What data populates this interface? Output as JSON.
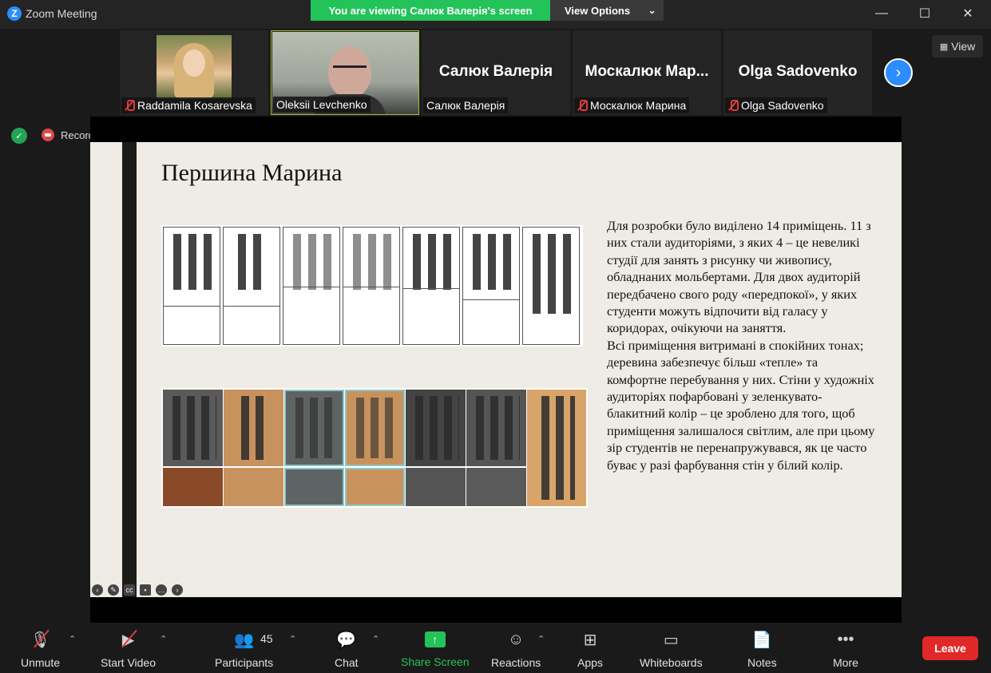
{
  "window": {
    "title": "Zoom Meeting",
    "logo_letter": "Z",
    "banner_text": "You are viewing Салюк Валерія's screen",
    "view_options": "View Options",
    "minimize": "—",
    "maximize": "☐",
    "close": "✕"
  },
  "thumbnails": [
    {
      "name": "Raddamila Kosarevska",
      "muted": true,
      "type": "photo"
    },
    {
      "name": "Oleksii Levchenko",
      "muted": false,
      "type": "camera",
      "active": true
    },
    {
      "name": "Салюк Валерія",
      "big_name": "Салюк Валерія",
      "muted": false,
      "type": "name"
    },
    {
      "name": "Москалюк Марина",
      "big_name": "Москалюк  Мар...",
      "muted": true,
      "type": "name"
    },
    {
      "name": "Olga Sadovenko",
      "big_name": "Olga Sadovenko",
      "muted": true,
      "type": "name"
    }
  ],
  "view_button": "View",
  "recording": "Recording",
  "slide": {
    "title": "Першина Марина",
    "paragraphs": [
      "Для розробки було виділено 14 приміщень. 11 з них стали аудиторіями, з яких 4 – це невеликі студії для занять з рисунку чи живопису, обладнаних мольбертами. Для двох аудиторій передбачено свого роду «передпокої», у яких студенти можуть відпочити від галасу у коридорах, очікуючи на заняття.",
      "Всі приміщення витримані в спокійних тонах; деревина забезпечує більш «тепле» та комфортне перебування у них. Стіни у художніх аудиторіях пофарбовані у зеленкувато-блакитний колір – це зроблено для того, щоб приміщення залишалося світлим, але при цьому зір студентів не перенапружувався, як це часто буває у разі фарбування стін у білий колір."
    ]
  },
  "toolbar": {
    "unmute": "Unmute",
    "start_video": "Start Video",
    "participants": "Participants",
    "participants_count": "45",
    "chat": "Chat",
    "share_screen": "Share Screen",
    "reactions": "Reactions",
    "apps": "Apps",
    "whiteboards": "Whiteboards",
    "notes": "Notes",
    "more": "More",
    "leave": "Leave"
  },
  "colors": {
    "accent_green": "#23c35a",
    "zoom_blue": "#2d8cff",
    "leave_red": "#e02828"
  }
}
